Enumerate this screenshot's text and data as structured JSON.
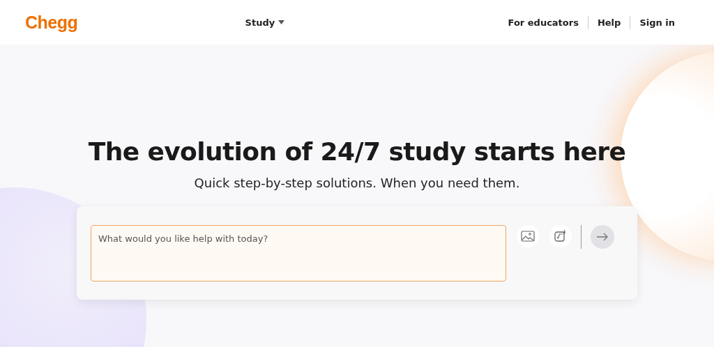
{
  "header": {
    "logo": "Chegg",
    "nav": [
      {
        "label": "Study",
        "has_menu": true
      }
    ],
    "links": [
      "For educators",
      "Help",
      "Sign in"
    ]
  },
  "hero": {
    "title": "The evolution of 24/7 study starts here",
    "subtitle": "Quick step-by-step solutions. When you need them.",
    "search": {
      "placeholder": "What would you like help with today?",
      "submit_disabled": true
    }
  }
}
